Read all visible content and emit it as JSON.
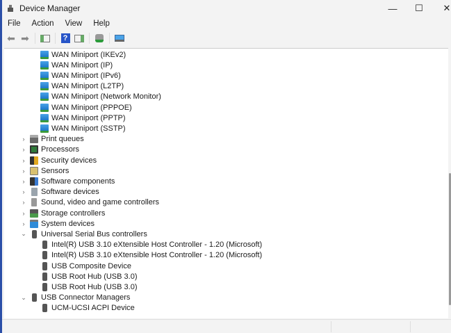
{
  "window": {
    "title": "Device Manager",
    "minimize": "—",
    "maximize": "☐",
    "close": "✕"
  },
  "menu": [
    "File",
    "Action",
    "View",
    "Help"
  ],
  "toolbar": [
    "back",
    "forward",
    "show-hide-console-tree",
    "help",
    "properties",
    "scan-hardware-changes",
    "computer"
  ],
  "tree": [
    {
      "label": "WAN Miniport (IKEv2)",
      "level": 1,
      "icon": "net"
    },
    {
      "label": "WAN Miniport (IP)",
      "level": 1,
      "icon": "net"
    },
    {
      "label": "WAN Miniport (IPv6)",
      "level": 1,
      "icon": "net"
    },
    {
      "label": "WAN Miniport (L2TP)",
      "level": 1,
      "icon": "net"
    },
    {
      "label": "WAN Miniport (Network Monitor)",
      "level": 1,
      "icon": "net"
    },
    {
      "label": "WAN Miniport (PPPOE)",
      "level": 1,
      "icon": "net"
    },
    {
      "label": "WAN Miniport (PPTP)",
      "level": 1,
      "icon": "net"
    },
    {
      "label": "WAN Miniport (SSTP)",
      "level": 1,
      "icon": "net"
    },
    {
      "label": "Print queues",
      "level": 0,
      "icon": "printer",
      "expanded": false
    },
    {
      "label": "Processors",
      "level": 0,
      "icon": "cpu",
      "expanded": false
    },
    {
      "label": "Security devices",
      "level": 0,
      "icon": "security",
      "expanded": false
    },
    {
      "label": "Sensors",
      "level": 0,
      "icon": "sensor",
      "expanded": false
    },
    {
      "label": "Software components",
      "level": 0,
      "icon": "swcomp",
      "expanded": false
    },
    {
      "label": "Software devices",
      "level": 0,
      "icon": "swdev",
      "expanded": false
    },
    {
      "label": "Sound, video and game controllers",
      "level": 0,
      "icon": "sound",
      "expanded": false
    },
    {
      "label": "Storage controllers",
      "level": 0,
      "icon": "storage",
      "expanded": false
    },
    {
      "label": "System devices",
      "level": 0,
      "icon": "system",
      "expanded": false
    },
    {
      "label": "Universal Serial Bus controllers",
      "level": 0,
      "icon": "usb",
      "expanded": true
    },
    {
      "label": "Intel(R) USB 3.10 eXtensible Host Controller - 1.20 (Microsoft)",
      "level": 1,
      "icon": "usb"
    },
    {
      "label": "Intel(R) USB 3.10 eXtensible Host Controller - 1.20 (Microsoft)",
      "level": 1,
      "icon": "usb"
    },
    {
      "label": "USB Composite Device",
      "level": 1,
      "icon": "usb"
    },
    {
      "label": "USB Root Hub (USB 3.0)",
      "level": 1,
      "icon": "usb"
    },
    {
      "label": "USB Root Hub (USB 3.0)",
      "level": 1,
      "icon": "usb"
    },
    {
      "label": "USB Connector Managers",
      "level": 0,
      "icon": "usb",
      "expanded": true
    },
    {
      "label": "UCM-UCSI ACPI Device",
      "level": 1,
      "icon": "usb"
    }
  ]
}
